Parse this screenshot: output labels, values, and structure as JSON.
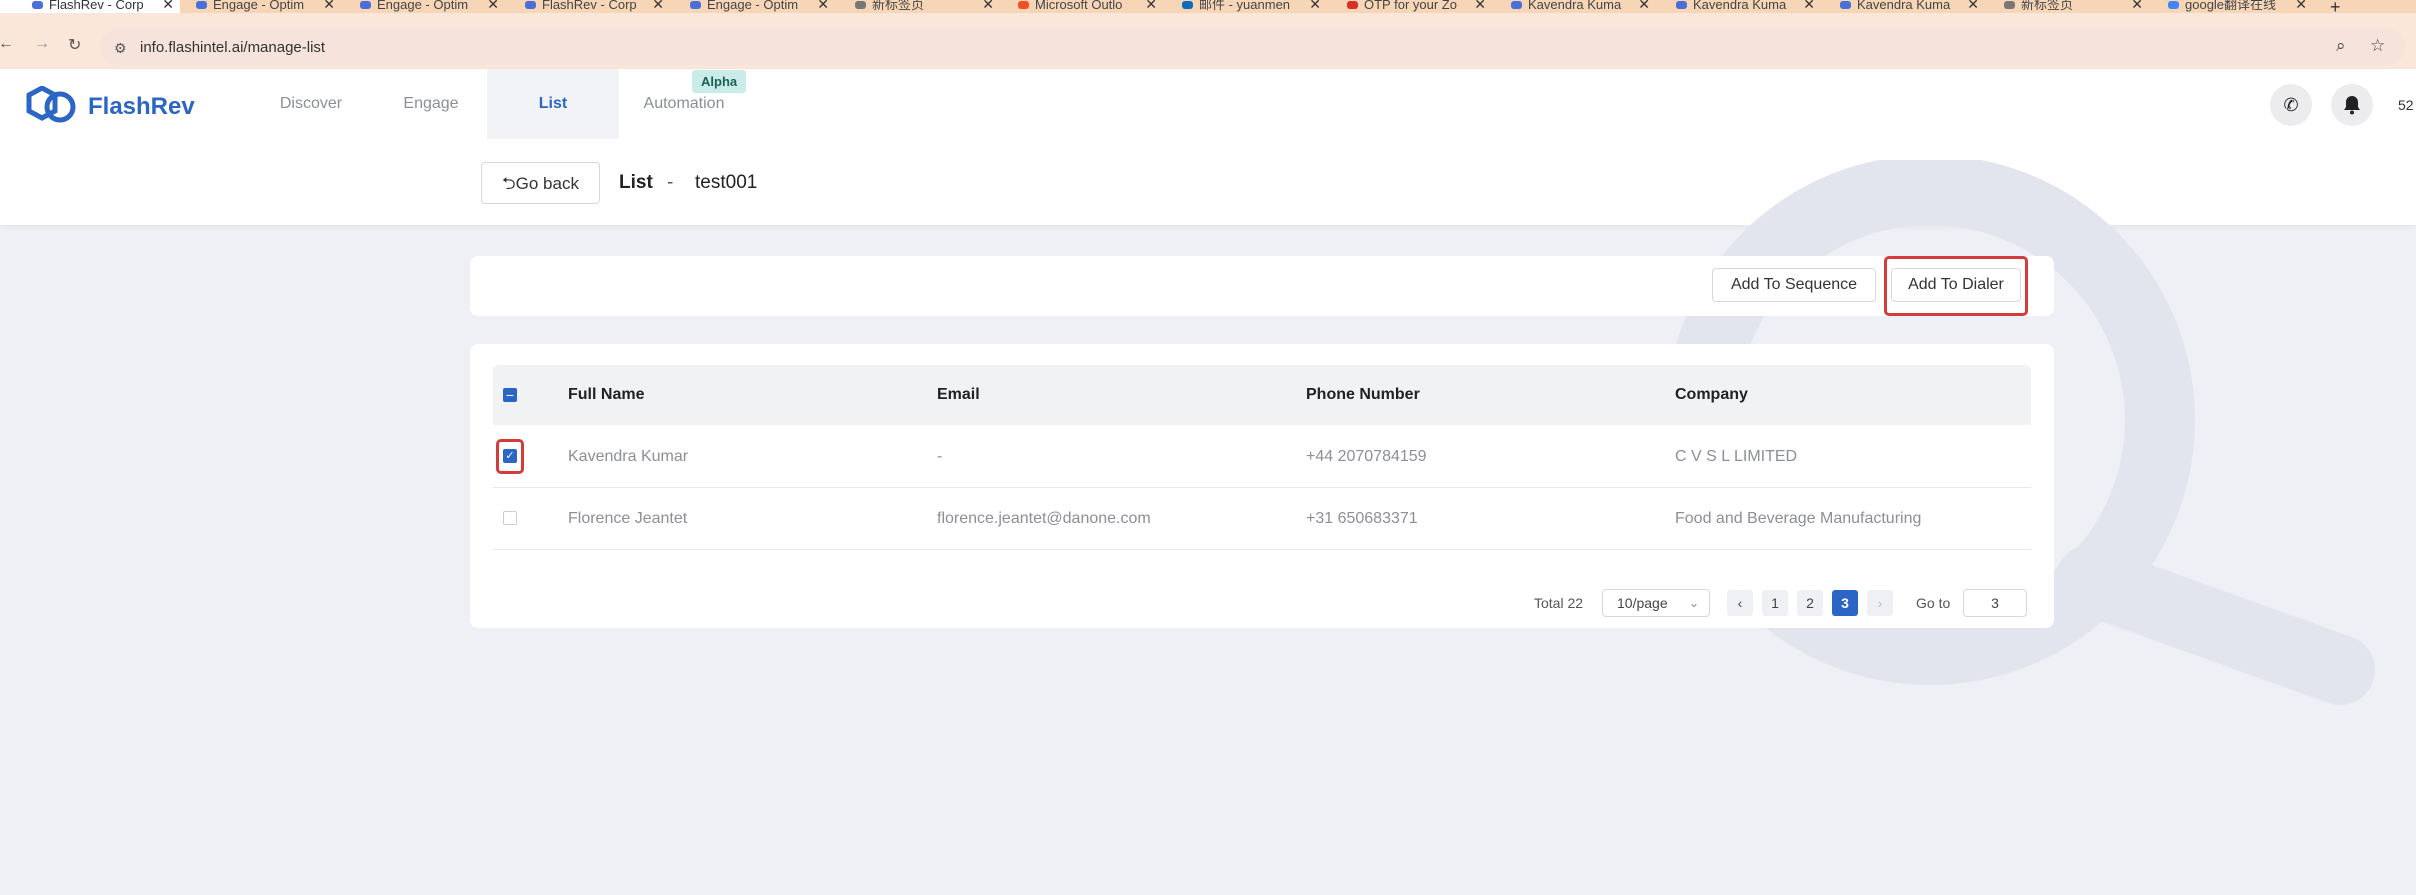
{
  "browser": {
    "tabs": [
      {
        "title": "FlashRev - Corp",
        "icon_color": "#4a6fd6"
      },
      {
        "title": "Engage - Optim",
        "icon_color": "#4a6fd6"
      },
      {
        "title": "Engage - Optim",
        "icon_color": "#4a6fd6"
      },
      {
        "title": "FlashRev - Corp",
        "icon_color": "#4a6fd6"
      },
      {
        "title": "Engage - Optim",
        "icon_color": "#4a6fd6"
      },
      {
        "title": "新标签页",
        "icon_color": "#777777"
      },
      {
        "title": "Microsoft Outlo",
        "icon_color": "#f25022"
      },
      {
        "title": "邮件 - yuanmen",
        "icon_color": "#0f6cbd"
      },
      {
        "title": "OTP for your Zo",
        "icon_color": "#d93025"
      },
      {
        "title": "Kavendra Kuma",
        "icon_color": "#4a6fd6"
      },
      {
        "title": "Kavendra Kuma",
        "icon_color": "#4a6fd6"
      },
      {
        "title": "Kavendra Kuma",
        "icon_color": "#4a6fd6"
      },
      {
        "title": "新标签页",
        "icon_color": "#777777"
      },
      {
        "title": "google翻译在线",
        "icon_color": "#4285f4"
      }
    ],
    "url": "info.flashintel.ai/manage-list"
  },
  "app": {
    "brand": "FlashRev",
    "nav": {
      "discover": "Discover",
      "engage": "Engage",
      "list": "List",
      "automation": "Automation",
      "alpha_badge": "Alpha"
    },
    "header_count": "52",
    "go_back": "Go back",
    "list_label": "List",
    "list_separator": "-",
    "list_name": "test001",
    "accent_color": "#2b66c5"
  },
  "actions": {
    "add_to_sequence": "Add To Sequence",
    "add_to_dialer": "Add To Dialer"
  },
  "table": {
    "columns": [
      "Full Name",
      "Email",
      "Phone Number",
      "Company"
    ],
    "rows": [
      {
        "checked": true,
        "full_name": "Kavendra Kumar",
        "email": "-",
        "phone": "+44 2070784159",
        "company": "C V S L LIMITED"
      },
      {
        "checked": false,
        "full_name": "Florence Jeantet",
        "email": "florence.jeantet@danone.com",
        "phone": "+31 650683371",
        "company": "Food and Beverage Manufacturing"
      }
    ]
  },
  "pagination": {
    "total": "Total 22",
    "page_size": "10/page",
    "pages": [
      "1",
      "2",
      "3"
    ],
    "current_page": "3",
    "goto_label": "Go to",
    "goto_value": "3"
  }
}
